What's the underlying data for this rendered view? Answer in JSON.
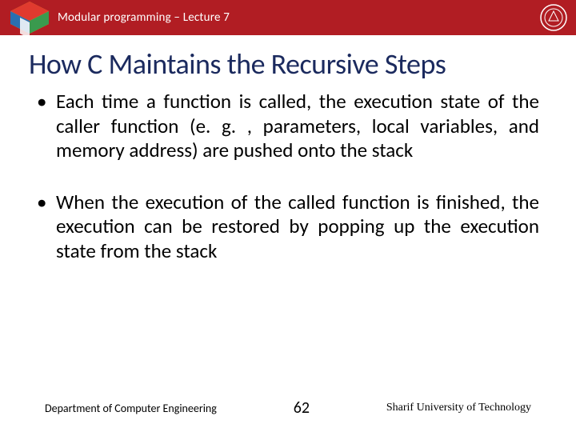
{
  "header": {
    "course_label": "Modular programming – Lecture 7",
    "logo_left_alt": "colored-cube-logo",
    "logo_right_alt": "university-seal"
  },
  "title": "How C Maintains the Recursive Steps",
  "bullets": [
    "Each time a function is called, the execution state of the caller function (e. g. , parameters, local variables, and memory address) are pushed onto the stack",
    "When the execution of the called function is finished, the execution can be restored by popping up the execution state from the stack"
  ],
  "footer": {
    "department": "Department of Computer Engineering",
    "page_number": "62",
    "university": "Sharif University of Technology"
  },
  "colors": {
    "brand_red": "#b11d23",
    "title_navy": "#1b2a5e"
  }
}
